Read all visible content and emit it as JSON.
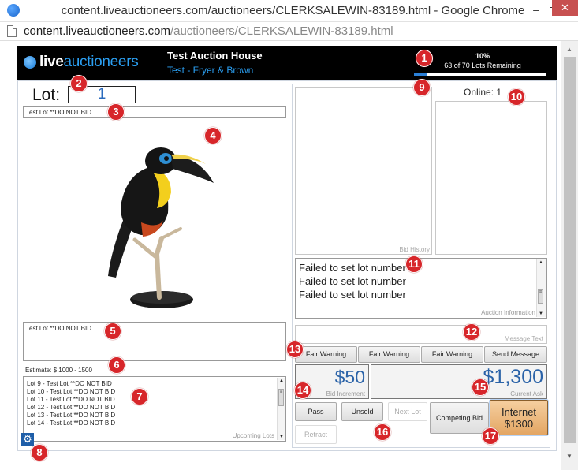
{
  "window": {
    "title": "content.liveauctioneers.com/auctioneers/CLERKSALEWIN-83189.html - Google Chrome",
    "min_glyph": "–",
    "close_glyph": "✕"
  },
  "address": {
    "host": "content.liveauctioneers.com",
    "path": "/auctioneers/CLERKSALEWIN-83189.html"
  },
  "header": {
    "logo_live": "live",
    "logo_auctioneers": "auctioneers",
    "house_name": "Test Auction House",
    "sale_name": "Test - Fryer & Brown",
    "progress_pct_label": "10%",
    "progress_value": 0.1,
    "lots_remaining": "63 of 70 Lots Remaining"
  },
  "lot": {
    "label": "Lot:",
    "number": "1",
    "title": "Test Lot **DO NOT BID",
    "description": "Test Lot **DO NOT BID",
    "estimate": "Estimate: $ 1000 - 1500"
  },
  "upcoming": {
    "label": "Upcoming Lots",
    "items": [
      "Lot 9 - Test Lot **DO NOT BID",
      "Lot 10 - Test Lot **DO NOT BID",
      "Lot 11 - Test Lot **DO NOT BID",
      "Lot 12 - Test Lot **DO NOT BID",
      "Lot 13 - Test Lot **DO NOT BID",
      "Lot 14 - Test Lot **DO NOT BID"
    ]
  },
  "panels": {
    "bid_history_label": "Bid History",
    "online_label": "Online: 1",
    "auction_info_label": "Auction Information",
    "auction_info": [
      "Failed to set lot number",
      "Failed to set lot number",
      "Failed to set lot number"
    ],
    "message_label": "Message Text"
  },
  "buttons": {
    "fair_warning_1": "Fair Warning",
    "fair_warning_2": "Fair Warning",
    "fair_warning_3": "Fair Warning",
    "send_message": "Send Message",
    "pass": "Pass",
    "unsold": "Unsold",
    "next_lot": "Next Lot",
    "competing_bid": "Competing Bid",
    "internet_label": "Internet",
    "internet_amount": "$1300",
    "retract": "Retract"
  },
  "bidding": {
    "increment": "$50",
    "increment_label": "Bid Increment",
    "current_ask": "$1,300",
    "current_ask_label": "Current Ask"
  },
  "markers": [
    "1",
    "2",
    "3",
    "4",
    "5",
    "6",
    "7",
    "8",
    "9",
    "10",
    "11",
    "12",
    "13",
    "14",
    "15",
    "16",
    "17"
  ],
  "colors": {
    "brand_blue": "#2b9ff2",
    "marker_red": "#d7262a",
    "internet_button": "#e3a663"
  }
}
